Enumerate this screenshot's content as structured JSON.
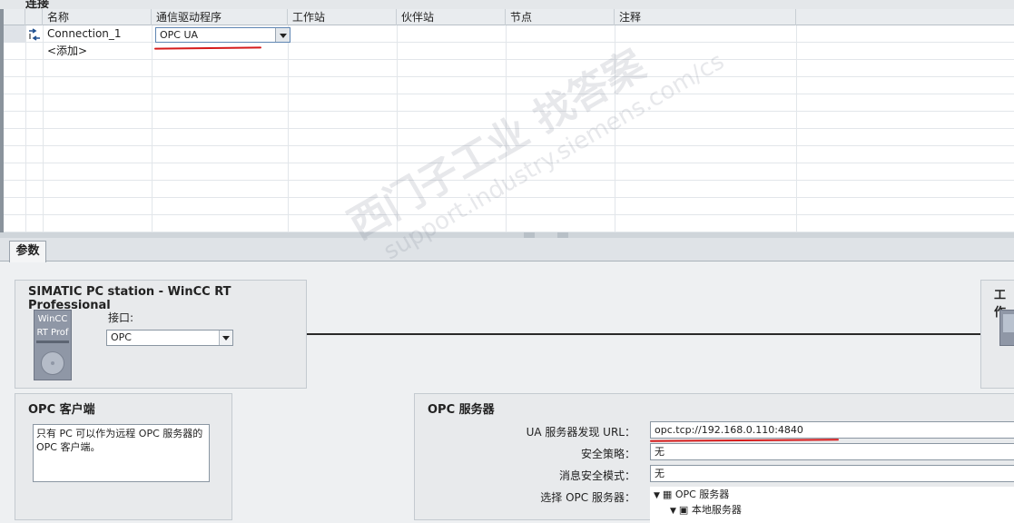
{
  "section_title": "连接",
  "table": {
    "columns": [
      "名称",
      "通信驱动程序",
      "工作站",
      "伙伴站",
      "节点",
      "注释"
    ],
    "rows": [
      {
        "name": "Connection_1",
        "driver": "OPC UA"
      }
    ],
    "add_label": "<添加>"
  },
  "tabs": [
    "参数"
  ],
  "station_panel": {
    "title": "SIMATIC PC station - WinCC RT Professional",
    "icon_line1": "WinCC",
    "icon_line2": "RT Prof",
    "interface_label": "接口:",
    "interface_value": "OPC"
  },
  "right_panel": {
    "title_fragment": "工作"
  },
  "opc_client": {
    "title": "OPC 客户端",
    "note": "只有 PC 可以作为远程 OPC 服务器的 OPC 客户端。"
  },
  "opc_server": {
    "title": "OPC 服务器",
    "fields": [
      {
        "label": "UA 服务器发现 URL：",
        "value": "opc.tcp://192.168.0.110:4840"
      },
      {
        "label": "安全策略：",
        "value": "无"
      },
      {
        "label": "消息安全模式：",
        "value": "无"
      }
    ],
    "select_label": "选择 OPC 服务器：",
    "tree_root": "OPC 服务器",
    "tree_child": "本地服务器"
  },
  "watermark": {
    "line1": "西门子工业  找答案",
    "line2": "support.industry.siemens.com/cs"
  },
  "colors": {
    "annotation_red": "#d61b1b",
    "selection_blue": "#5f86b3"
  }
}
